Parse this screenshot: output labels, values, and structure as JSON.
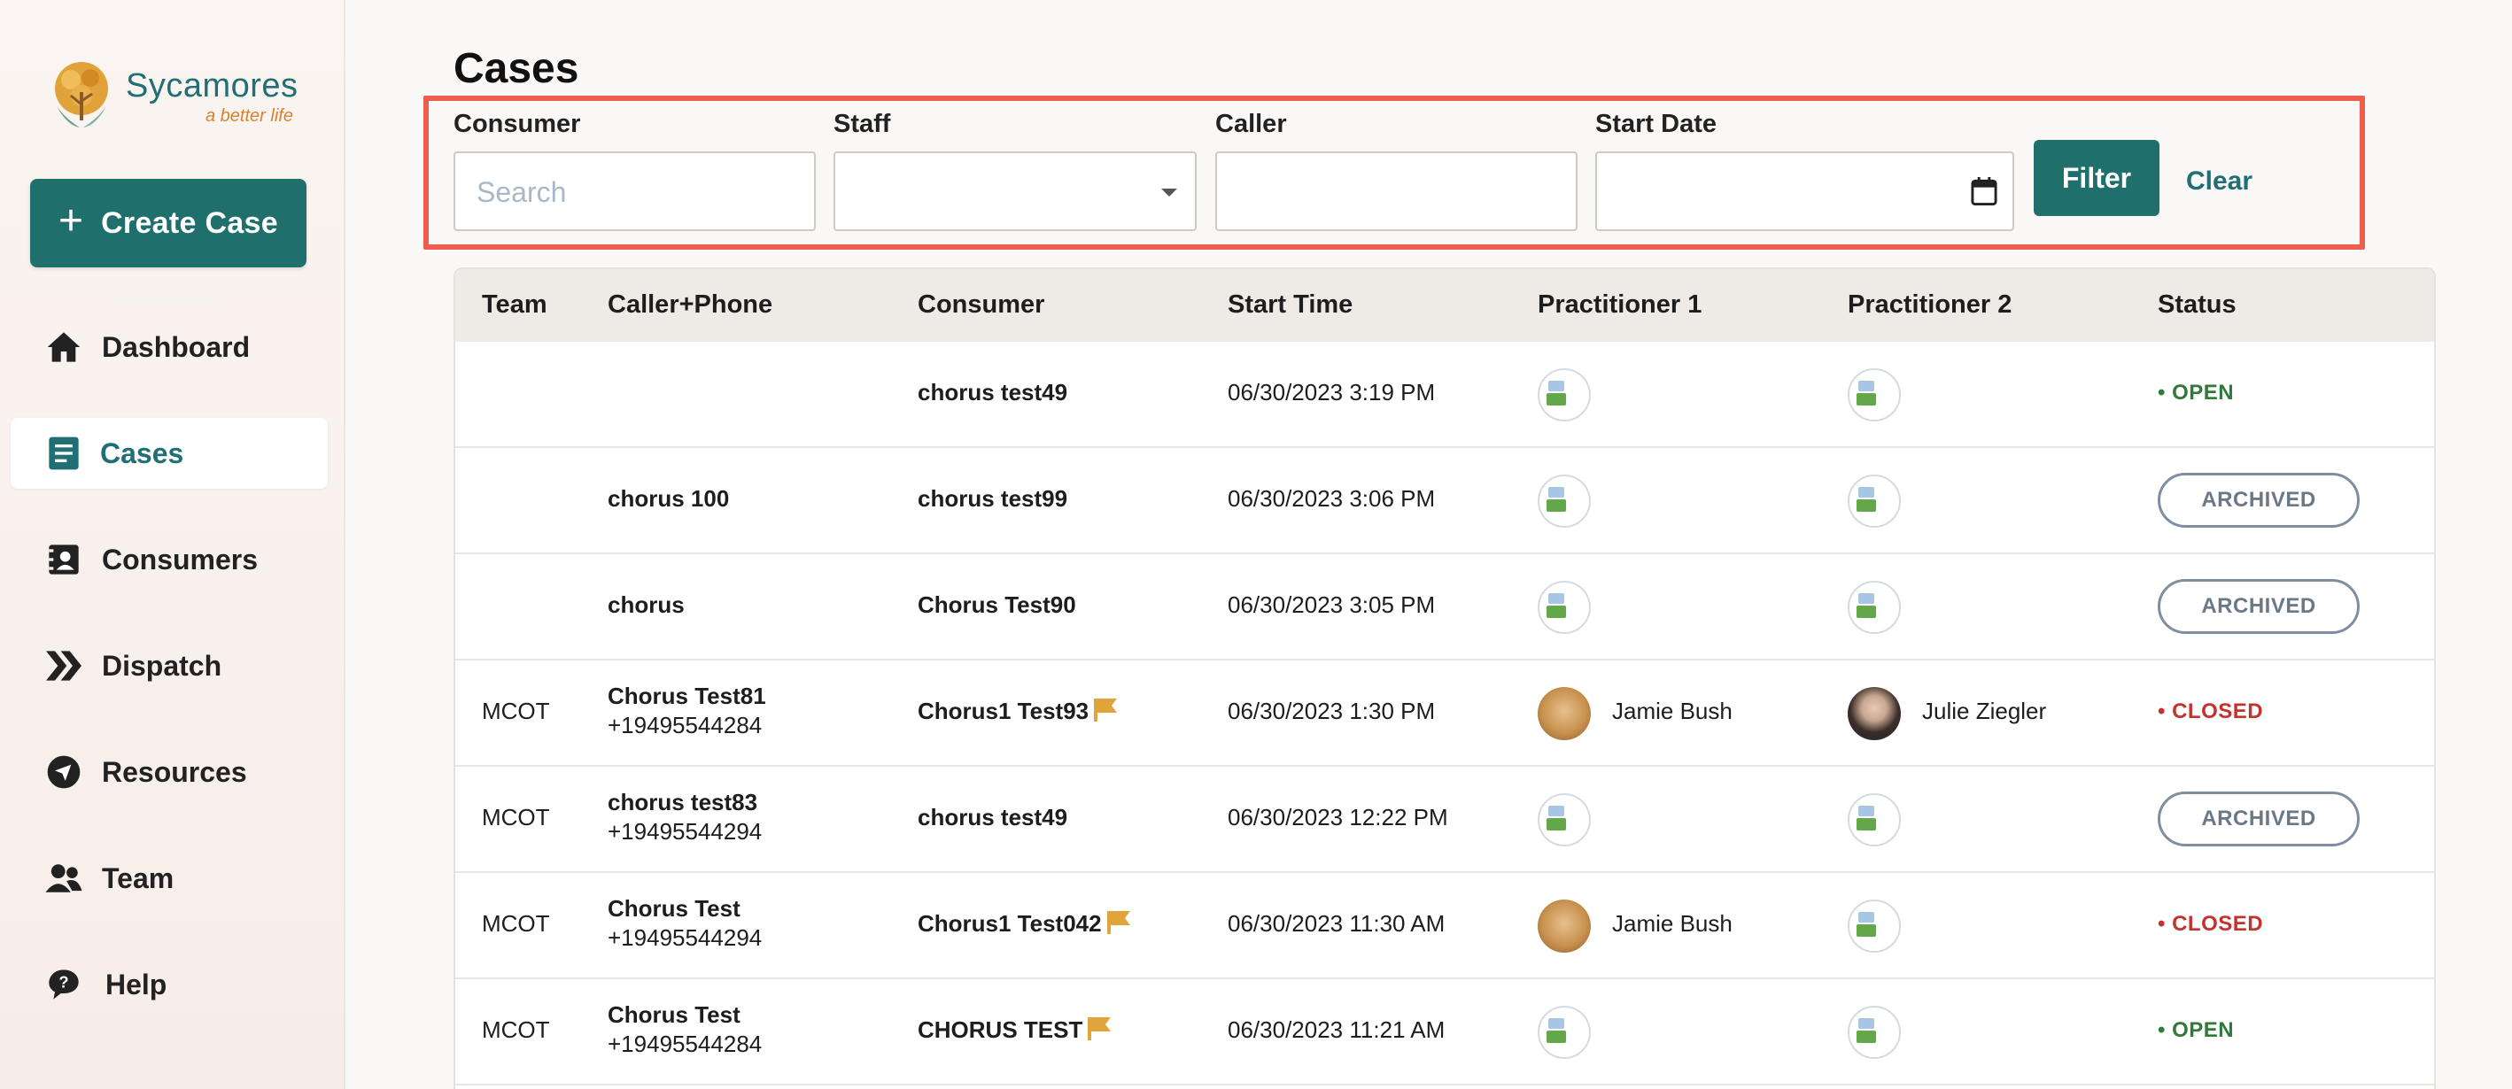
{
  "brand": {
    "name": "Sycamores",
    "tagline": "a better life"
  },
  "sidebar": {
    "create_label": "Create Case",
    "items": [
      {
        "label": "Dashboard",
        "icon": "home-icon"
      },
      {
        "label": "Cases",
        "icon": "cases-icon",
        "active": true
      },
      {
        "label": "Consumers",
        "icon": "consumers-icon"
      },
      {
        "label": "Dispatch",
        "icon": "dispatch-icon"
      },
      {
        "label": "Resources",
        "icon": "resources-icon"
      },
      {
        "label": "Team",
        "icon": "team-icon"
      },
      {
        "label": "Help",
        "icon": "help-icon"
      }
    ]
  },
  "page": {
    "title": "Cases"
  },
  "filters": {
    "consumer_label": "Consumer",
    "consumer_placeholder": "Search",
    "staff_label": "Staff",
    "caller_label": "Caller",
    "start_date_label": "Start Date",
    "filter_label": "Filter",
    "clear_label": "Clear"
  },
  "table": {
    "headers": [
      "Team",
      "Caller+Phone",
      "Consumer",
      "Start Time",
      "Practitioner 1",
      "Practitioner 2",
      "Status"
    ],
    "rows": [
      {
        "team": "",
        "caller": "",
        "phone": "",
        "consumer": "chorus test49",
        "flag": false,
        "start": "06/30/2023 3:19 PM",
        "p1": "",
        "p1_avatar": "broken",
        "p2": "",
        "p2_avatar": "broken",
        "status": "OPEN"
      },
      {
        "team": "",
        "caller": "chorus 100",
        "phone": "",
        "consumer": "chorus test99",
        "flag": false,
        "start": "06/30/2023 3:06 PM",
        "p1": "",
        "p1_avatar": "broken",
        "p2": "",
        "p2_avatar": "broken",
        "status": "ARCHIVED"
      },
      {
        "team": "",
        "caller": "chorus",
        "phone": "",
        "consumer": "Chorus Test90",
        "flag": false,
        "start": "06/30/2023 3:05 PM",
        "p1": "",
        "p1_avatar": "broken",
        "p2": "",
        "p2_avatar": "broken",
        "status": "ARCHIVED"
      },
      {
        "team": "MCOT",
        "caller": "Chorus Test81",
        "phone": "+19495544284",
        "consumer": "Chorus1 Test93",
        "flag": true,
        "start": "06/30/2023 1:30 PM",
        "p1": "Jamie Bush",
        "p1_avatar": "dog",
        "p2": "Julie Ziegler",
        "p2_avatar": "woman",
        "status": "CLOSED"
      },
      {
        "team": "MCOT",
        "caller": "chorus test83",
        "phone": "+19495544294",
        "consumer": "chorus test49",
        "flag": false,
        "start": "06/30/2023 12:22 PM",
        "p1": "",
        "p1_avatar": "broken",
        "p2": "",
        "p2_avatar": "broken",
        "status": "ARCHIVED"
      },
      {
        "team": "MCOT",
        "caller": "Chorus Test",
        "phone": "+19495544294",
        "consumer": "Chorus1 Test042",
        "flag": true,
        "start": "06/30/2023 11:30 AM",
        "p1": "Jamie Bush",
        "p1_avatar": "dog",
        "p2": "",
        "p2_avatar": "broken",
        "status": "CLOSED"
      },
      {
        "team": "MCOT",
        "caller": "Chorus Test",
        "phone": "+19495544284",
        "consumer": "CHORUS TEST",
        "flag": true,
        "start": "06/30/2023 11:21 AM",
        "p1": "",
        "p1_avatar": "broken",
        "p2": "",
        "p2_avatar": "broken",
        "status": "OPEN"
      }
    ]
  },
  "colors": {
    "brand": "#1f6f6c",
    "open": "#2f7a3a",
    "closed": "#c4322c",
    "archived": "#6a7888",
    "flag": "#e0a43a",
    "highlight": "#ef5d4f"
  }
}
